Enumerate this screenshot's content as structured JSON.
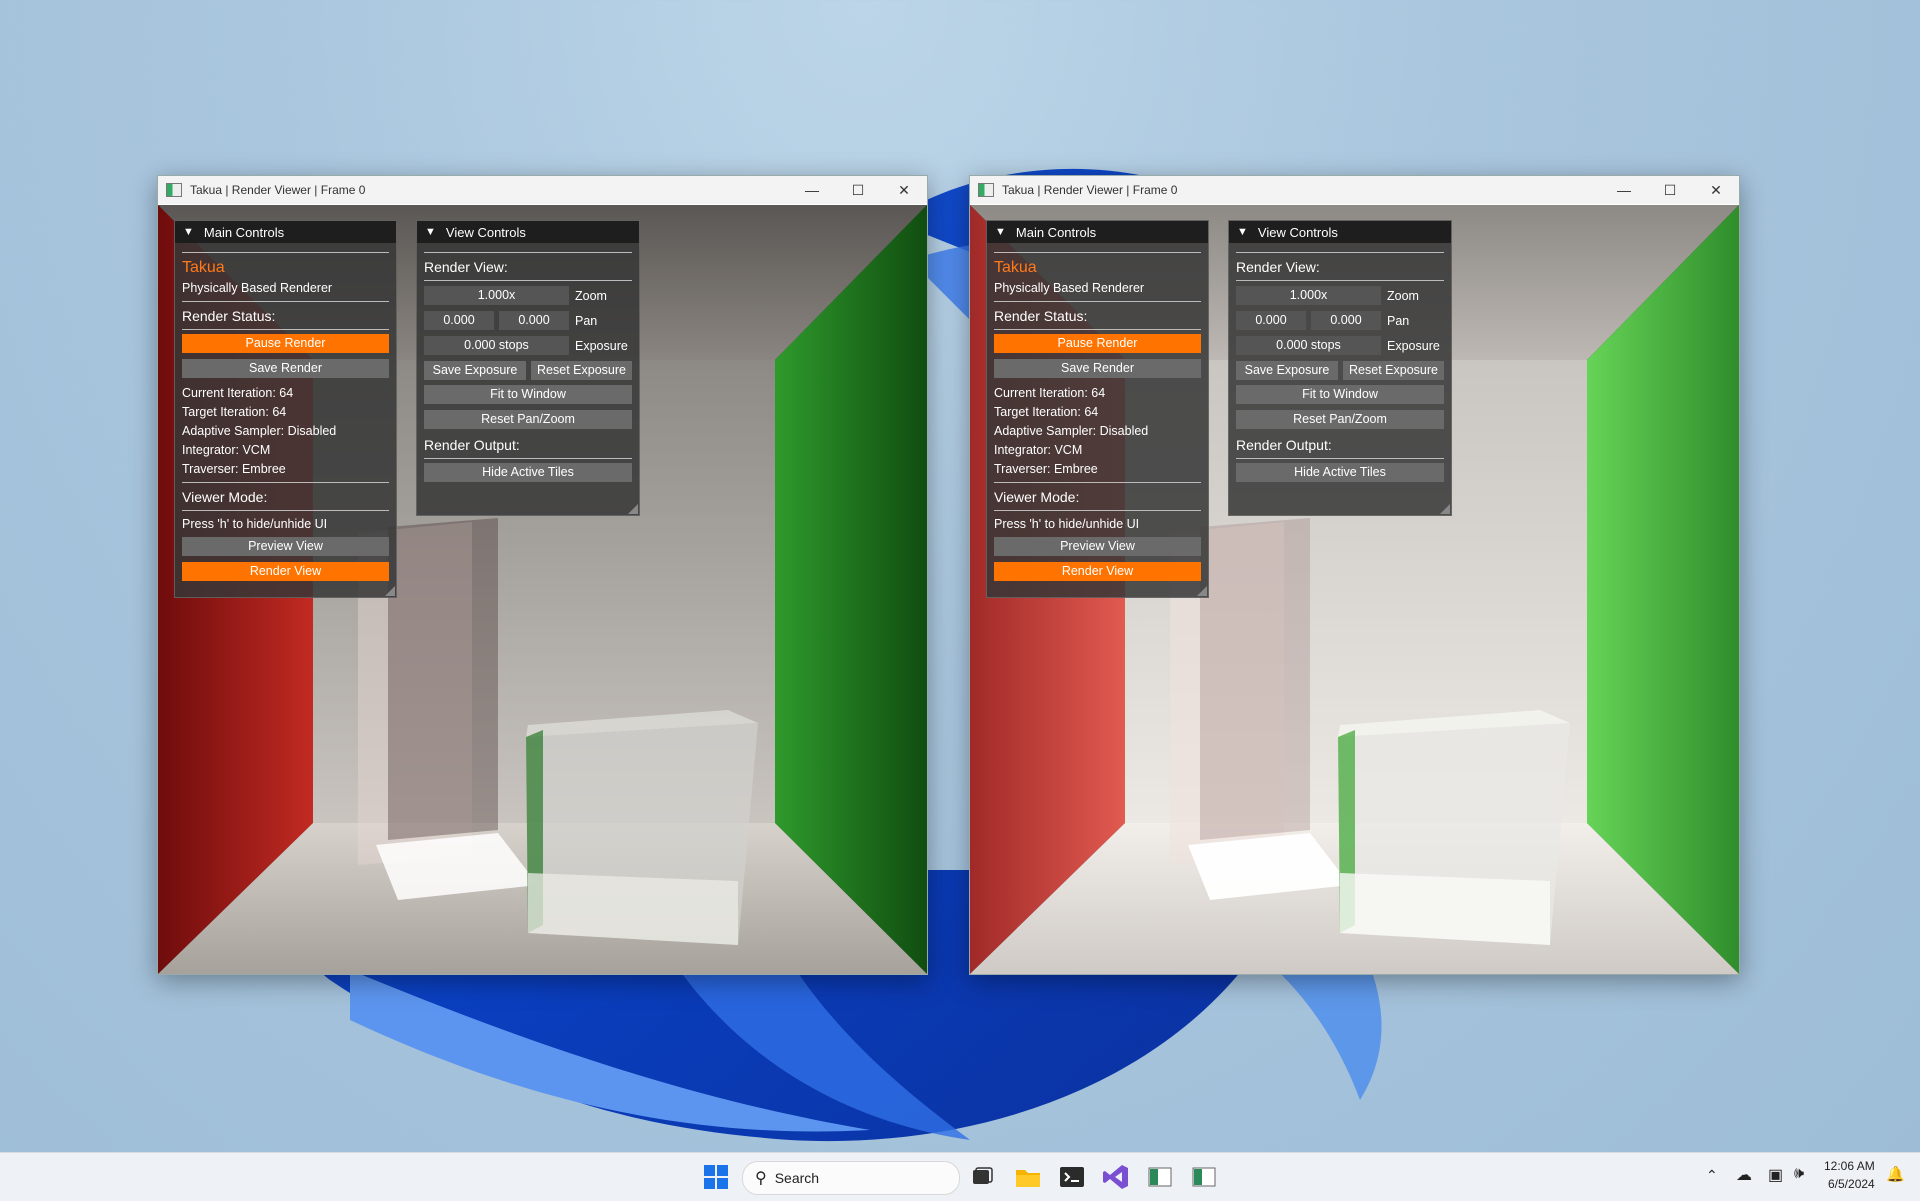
{
  "windows": [
    {
      "title": "Takua | Render Viewer | Frame 0",
      "main_controls": {
        "header": "Main Controls",
        "brand": "Takua",
        "subtitle": "Physically Based Renderer",
        "render_status_label": "Render Status:",
        "pause_render": "Pause Render",
        "save_render": "Save Render",
        "current_iteration": "Current Iteration: 64",
        "target_iteration": "Target Iteration: 64",
        "adaptive_sampler": "Adaptive Sampler: Disabled",
        "integrator": "Integrator: VCM",
        "traverser": "Traverser: Embree",
        "viewer_mode_label": "Viewer Mode:",
        "hint": "Press 'h' to hide/unhide UI",
        "preview_view": "Preview View",
        "render_view": "Render View"
      },
      "view_controls": {
        "header": "View Controls",
        "render_view_label": "Render View:",
        "zoom_value": "1.000x",
        "zoom_label": "Zoom",
        "pan_x": "0.000",
        "pan_y": "0.000",
        "pan_label": "Pan",
        "exposure_value": "0.000 stops",
        "exposure_label": "Exposure",
        "save_exposure": "Save Exposure",
        "reset_exposure": "Reset Exposure",
        "fit_to_window": "Fit to Window",
        "reset_pan_zoom": "Reset Pan/Zoom",
        "render_output_label": "Render Output:",
        "hide_active_tiles": "Hide Active Tiles"
      }
    },
    {
      "title": "Takua | Render Viewer | Frame 0",
      "main_controls": {
        "header": "Main Controls",
        "brand": "Takua",
        "subtitle": "Physically Based Renderer",
        "render_status_label": "Render Status:",
        "pause_render": "Pause Render",
        "save_render": "Save Render",
        "current_iteration": "Current Iteration: 64",
        "target_iteration": "Target Iteration: 64",
        "adaptive_sampler": "Adaptive Sampler: Disabled",
        "integrator": "Integrator: VCM",
        "traverser": "Traverser: Embree",
        "viewer_mode_label": "Viewer Mode:",
        "hint": "Press 'h' to hide/unhide UI",
        "preview_view": "Preview View",
        "render_view": "Render View"
      },
      "view_controls": {
        "header": "View Controls",
        "render_view_label": "Render View:",
        "zoom_value": "1.000x",
        "zoom_label": "Zoom",
        "pan_x": "0.000",
        "pan_y": "0.000",
        "pan_label": "Pan",
        "exposure_value": "0.000 stops",
        "exposure_label": "Exposure",
        "save_exposure": "Save Exposure",
        "reset_exposure": "Reset Exposure",
        "fit_to_window": "Fit to Window",
        "reset_pan_zoom": "Reset Pan/Zoom",
        "render_output_label": "Render Output:",
        "hide_active_tiles": "Hide Active Tiles"
      }
    }
  ],
  "taskbar": {
    "search_placeholder": "Search",
    "time": "12:06 AM",
    "date": "6/5/2024"
  },
  "colors": {
    "accent_orange": "#ff7400",
    "brand_orange": "#ff7a1a",
    "wall_red": "#b31b1b",
    "wall_green": "#1f8a1f"
  }
}
